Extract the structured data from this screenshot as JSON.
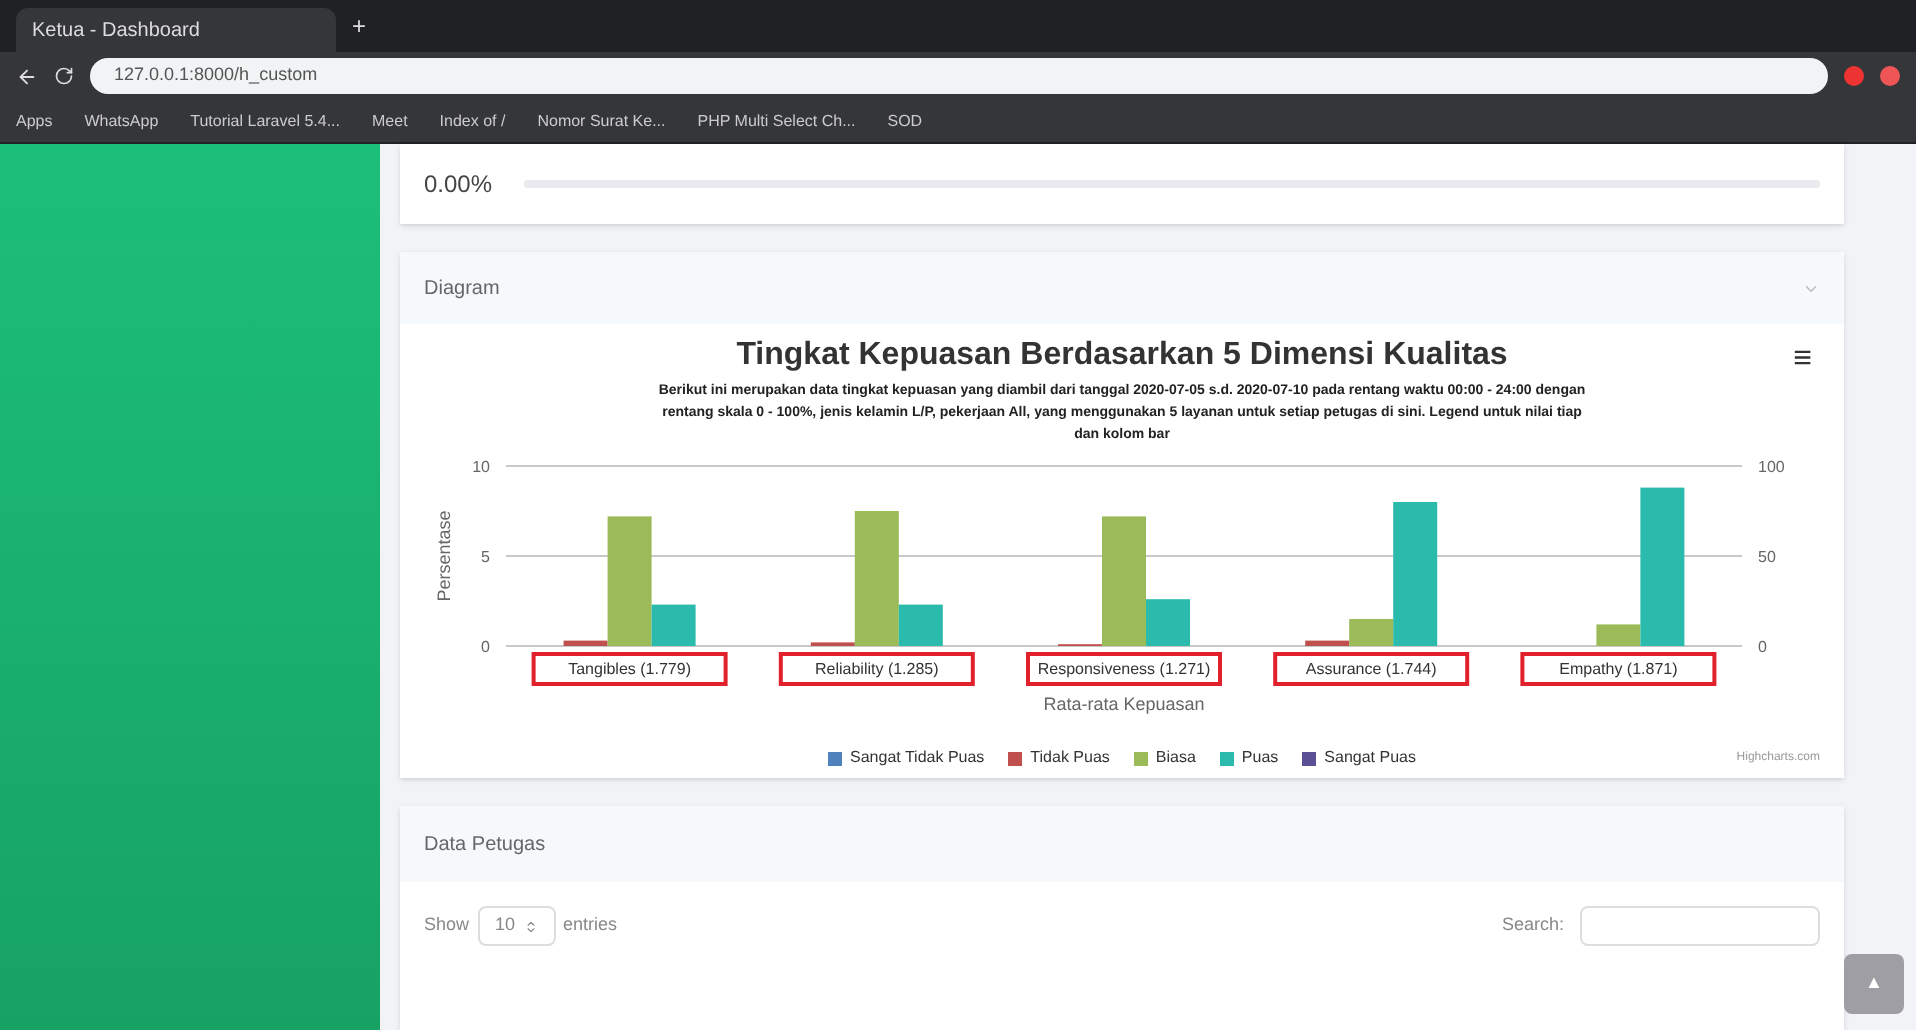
{
  "browser": {
    "tab_title": "Ketua - Dashboard",
    "new_tab": "+",
    "url": "127.0.0.1:8000/h_custom",
    "bookmarks": [
      {
        "label": "Apps"
      },
      {
        "label": "WhatsApp"
      },
      {
        "label": "Tutorial Laravel 5.4..."
      },
      {
        "label": "Meet"
      },
      {
        "label": "Index of /"
      },
      {
        "label": "Nomor Surat Ke..."
      },
      {
        "label": "PHP Multi Select Ch..."
      },
      {
        "label": "SOD"
      }
    ]
  },
  "progress_card": {
    "reading": "0.00%",
    "level": 0
  },
  "diagram_card": {
    "title": "Diagram",
    "menu": "≡",
    "subtitle": "Berikut ini merupakan data tingkat kepuasan yang diambil dari tanggal 2020-07-05 s.d. 2020-07-10 pada rentang waktu 00:00 - 24:00 dengan rentang skala 0 - 100%, jenis kelamin L/P, pekerjaan All, yang menggunakan 5 layanan untuk setiap petugas di sini. Legend untuk nilai tiap dan kolom bar",
    "credit": "Highcharts.com",
    "chart_data": {
      "type": "bar",
      "title": "Tingkat Kepuasan Berdasarkan 5 Dimensi Kualitas",
      "xlabel": "Rata-rata Kepuasan",
      "ylabel": "Persentase",
      "categories": [
        "Tangibles (1.779)",
        "Reliability (1.285)",
        "Responsiveness (1.271)",
        "Assurance (1.744)",
        "Empathy (1.871)"
      ],
      "series": [
        {
          "name": "Sangat Tidak Puas",
          "color": "#4f81bd",
          "values": [
            0,
            0,
            0,
            0,
            0
          ]
        },
        {
          "name": "Tidak Puas",
          "color": "#c0504d",
          "values": [
            0.3,
            0.2,
            0.1,
            0.3,
            0
          ]
        },
        {
          "name": "Biasa",
          "color": "#9bbb59",
          "values": [
            7.2,
            7.5,
            7.2,
            1.5,
            1.2
          ]
        },
        {
          "name": "Puas",
          "color": "#2bbbad",
          "values": [
            2.3,
            2.3,
            2.6,
            8,
            8.8
          ]
        },
        {
          "name": "Sangat Puas",
          "color": "#5b4f96",
          "values": [
            0,
            0,
            0,
            0,
            0
          ]
        }
      ],
      "ylim": [
        0,
        10
      ],
      "yticks": [
        0,
        5,
        10
      ],
      "y2lim": [
        0,
        100
      ],
      "y2ticks": [
        0,
        50,
        100
      ],
      "legend": "bottom"
    },
    "highlighted_labels": [
      true,
      true,
      true,
      true,
      true
    ]
  },
  "petugas_card": {
    "title": "Data Petugas",
    "show_label": "Show",
    "page_size": "10",
    "entries_label": "entries",
    "search_label": "Search:"
  },
  "scroll_top": "▲"
}
